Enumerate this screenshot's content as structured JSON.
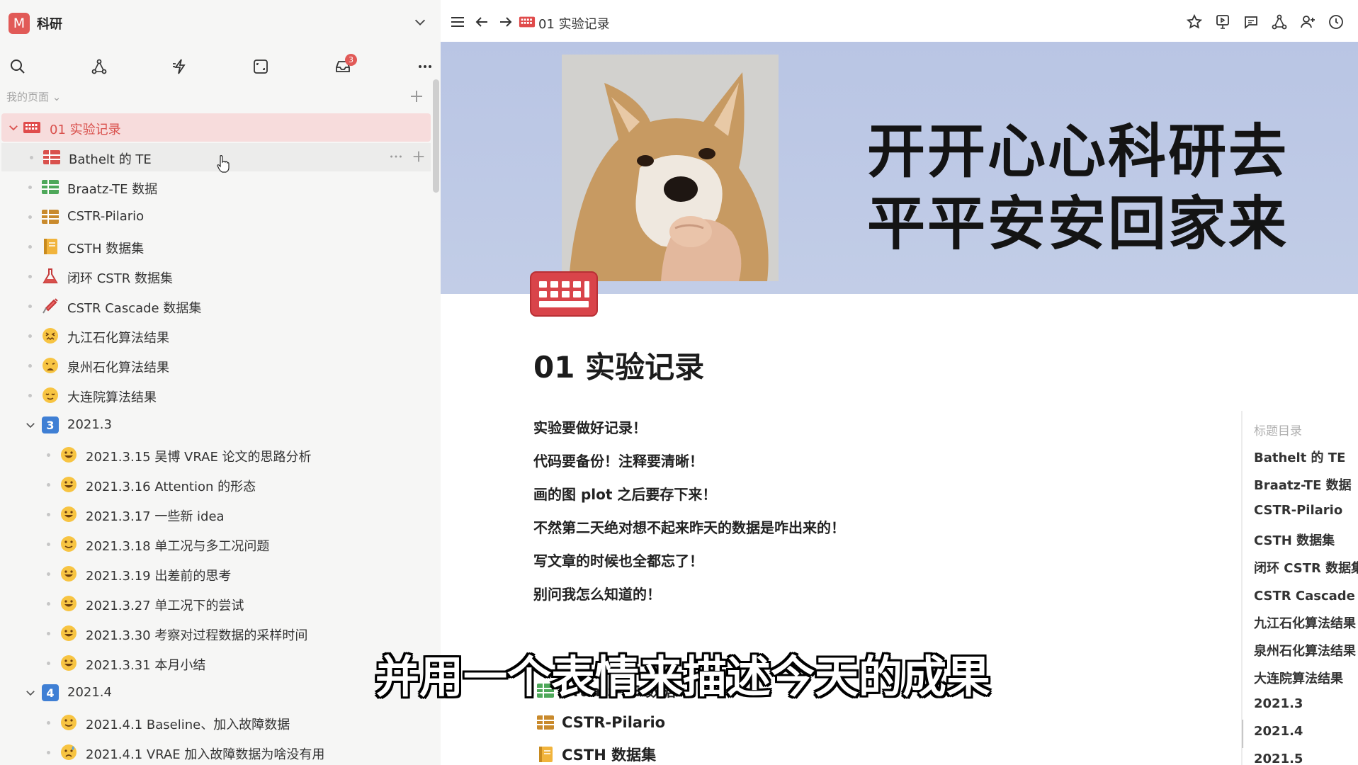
{
  "workspace": {
    "logo_letter": "M",
    "name": "科研",
    "accent": "#e15a57"
  },
  "tools": {
    "inbox_badge": "3"
  },
  "sidebar": {
    "section_label": "我的页面",
    "items": [
      {
        "label": "01 实验记录"
      },
      {
        "label": "Bathelt 的 TE"
      },
      {
        "label": "Braatz-TE 数据"
      },
      {
        "label": "CSTR-Pilario"
      },
      {
        "label": "CSTH 数据集"
      },
      {
        "label": "闭环 CSTR 数据集"
      },
      {
        "label": "CSTR Cascade 数据集"
      },
      {
        "label": "九江石化算法结果"
      },
      {
        "label": "泉州石化算法结果"
      },
      {
        "label": "大连院算法结果"
      },
      {
        "label": "2021.3",
        "badge": "3"
      },
      {
        "label": "2021.3.15 吴博 VRAE 论文的思路分析"
      },
      {
        "label": "2021.3.16 Attention 的形态"
      },
      {
        "label": "2021.3.17 一些新 idea"
      },
      {
        "label": "2021.3.18 单工况与多工况问题"
      },
      {
        "label": "2021.3.19 出差前的思考"
      },
      {
        "label": "2021.3.27 单工况下的尝试"
      },
      {
        "label": "2021.3.30 考察对过程数据的采样时间"
      },
      {
        "label": "2021.3.31 本月小结"
      },
      {
        "label": "2021.4",
        "badge": "4"
      },
      {
        "label": "2021.4.1 Baseline、加入故障数据"
      },
      {
        "label": "2021.4.1 VRAE 加入故障数据为啥没有用"
      }
    ]
  },
  "topbar": {
    "title": "01 实验记录"
  },
  "cover": {
    "line1": "开开心心科研去",
    "line2": "平平安安回家来"
  },
  "page": {
    "title": "01 实验记录",
    "paragraphs": [
      "实验要做好记录！",
      "代码要备份！注释要清晰！",
      "画的图 plot 之后要存下来！",
      "不然第二天绝对想不起来昨天的数据是咋出来的！",
      "写文章的时候也全都忘了！",
      "别问我怎么知道的！"
    ],
    "links": [
      "Braatz-TE 数据",
      "CSTR-Pilario",
      "CSTH 数据集"
    ]
  },
  "toc": {
    "title": "标题目录",
    "items": [
      "Bathelt 的 TE",
      "Braatz-TE 数据",
      "CSTR-Pilario",
      "CSTH 数据集",
      "闭环 CSTR 数据集",
      "CSTR Cascade 数据集",
      "九江石化算法结果",
      "泉州石化算法结果",
      "大连院算法结果",
      "2021.3",
      "2021.4",
      "2021.5"
    ]
  },
  "subtitle": "并用一个表情来描述今天的成果"
}
